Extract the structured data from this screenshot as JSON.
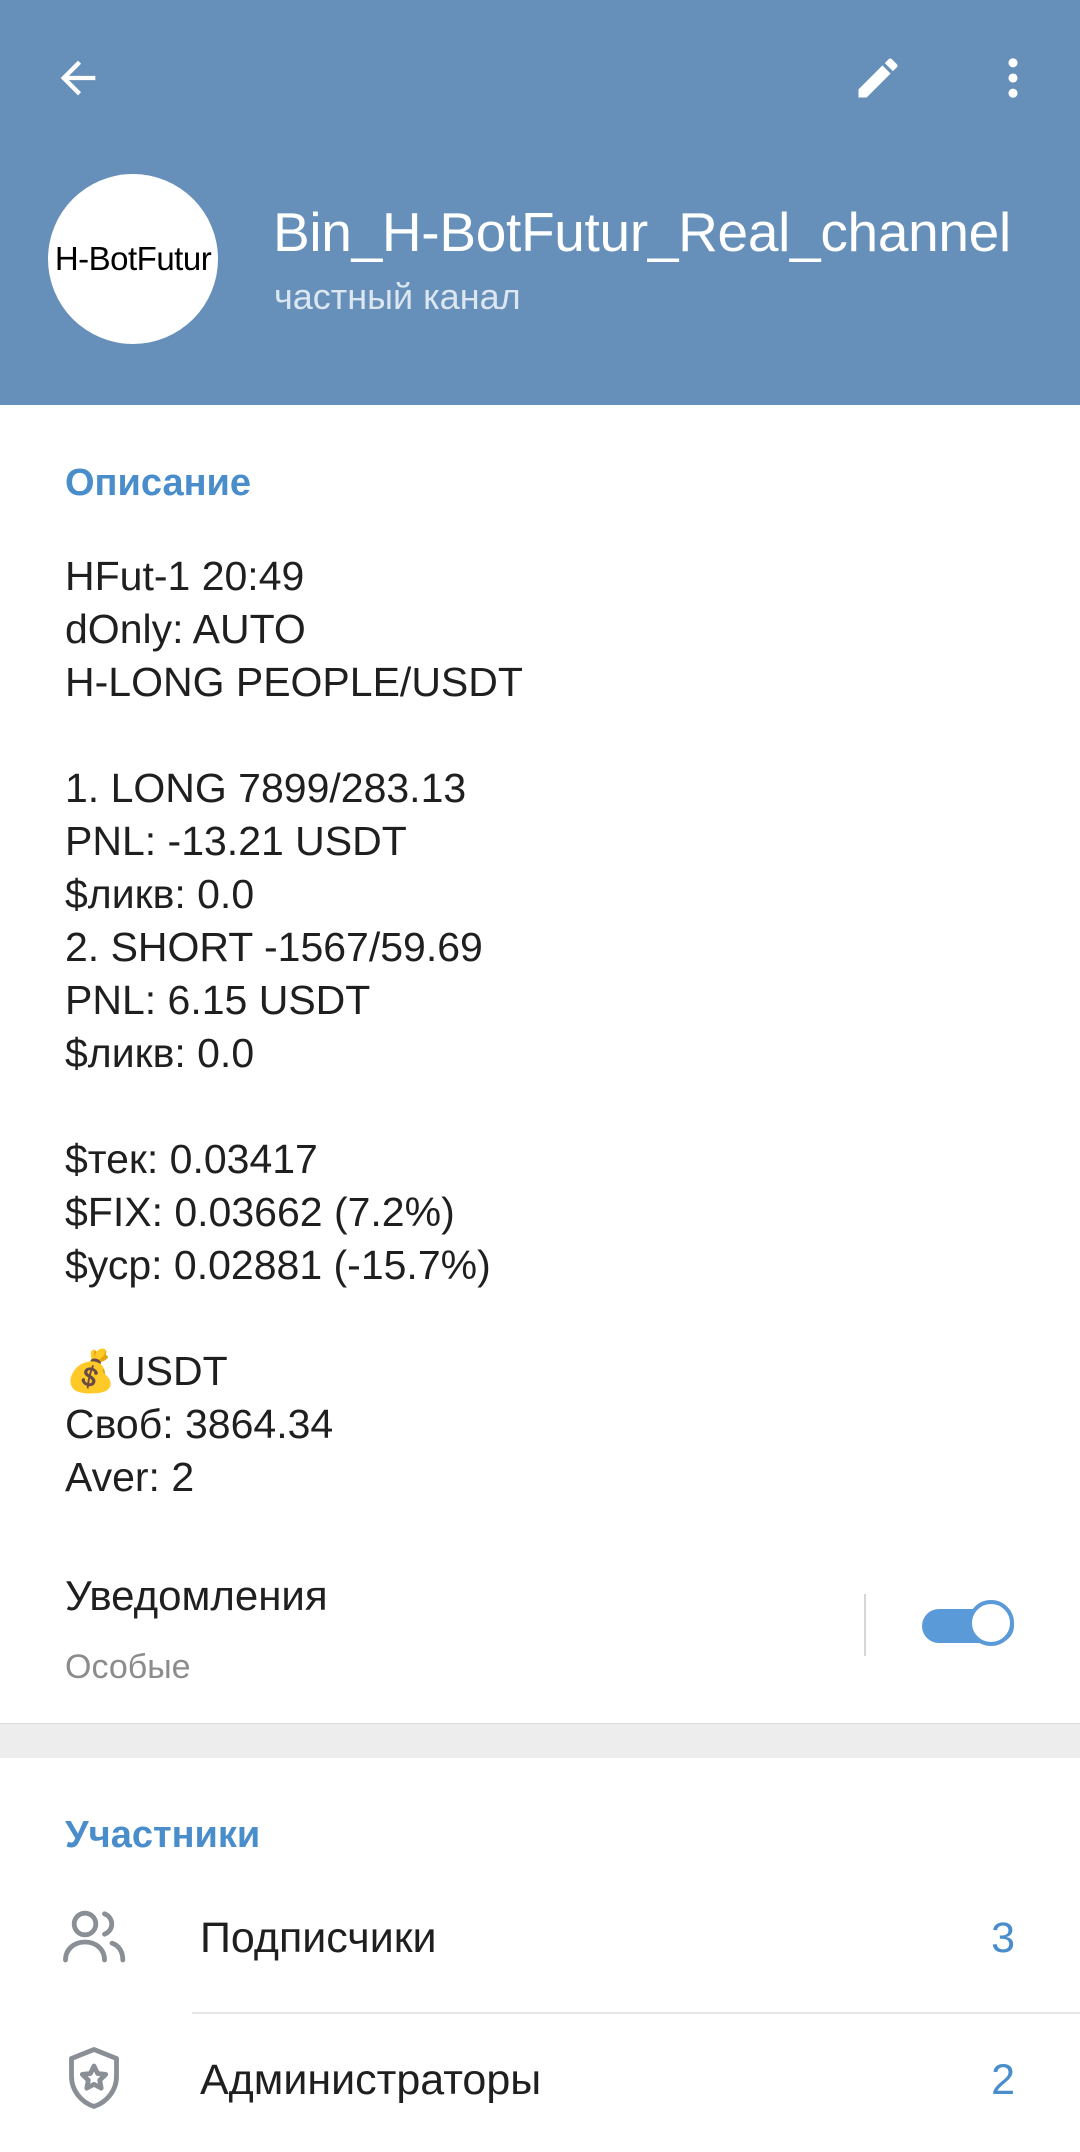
{
  "header": {
    "title": "Bin_H-BotFutur_Real_channel",
    "subtitle": "частный канал",
    "avatar_text": "H-BotFutur",
    "back_icon": "arrow-left-icon",
    "edit_icon": "pencil-icon",
    "more_icon": "more-vertical-icon"
  },
  "description": {
    "heading": "Описание",
    "lines": [
      "HFut-1 20:49",
      "dOnly: AUTO",
      "H-LONG PEOPLE/USDT",
      "",
      "1. LONG 7899/283.13",
      "PNL: -13.21 USDT",
      "$ликв: 0.0",
      "2. SHORT -1567/59.69",
      "PNL: 6.15 USDT",
      "$ликв: 0.0",
      "",
      "$тек: 0.03417",
      "$FIX: 0.03662 (7.2%)",
      "$уср: 0.02881 (-15.7%)",
      "",
      "💰USDT",
      "Своб: 3864.34",
      "Aver: 2"
    ]
  },
  "notifications": {
    "label": "Уведомления",
    "value": "Особые",
    "enabled": true
  },
  "members": {
    "heading": "Участники",
    "items": [
      {
        "label": "Подписчики",
        "count": "3",
        "icon": "users-icon"
      },
      {
        "label": "Администраторы",
        "count": "2",
        "icon": "admin-shield-icon"
      }
    ]
  },
  "colors": {
    "header_bg": "#6690b9",
    "accent": "#4a8dcb",
    "toggle_on": "#5a9ad8"
  }
}
